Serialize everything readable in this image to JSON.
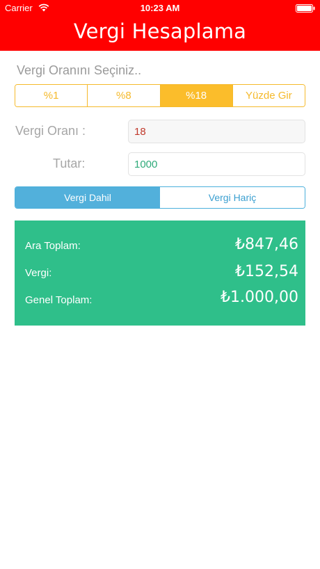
{
  "status_bar": {
    "carrier": "Carrier",
    "time": "10:23 AM"
  },
  "header": {
    "title": "Vergi Hesaplama",
    "background_color": "#ff0000"
  },
  "form": {
    "prompt": "Vergi Oranını Seçiniz..",
    "rate_options": [
      "%1",
      "%8",
      "%18",
      "Yüzde Gir"
    ],
    "selected_rate": "%18",
    "rate_label": "Vergi Oranı :",
    "rate_value": "18",
    "amount_label": "Tutar:",
    "amount_value": "1000",
    "mode_options": [
      "Vergi Dahil",
      "Vergi Hariç"
    ],
    "selected_mode": "Vergi Dahil",
    "accent_rate_color": "#fbbd2b",
    "accent_mode_color": "#52b0db"
  },
  "result": {
    "background_color": "#2fbf8a",
    "subtotal_label": "Ara Toplam:",
    "subtotal_value": "₺847,46",
    "tax_label": "Vergi:",
    "tax_value": "₺152,54",
    "total_label": "Genel Toplam:",
    "total_value": "₺1.000,00"
  }
}
